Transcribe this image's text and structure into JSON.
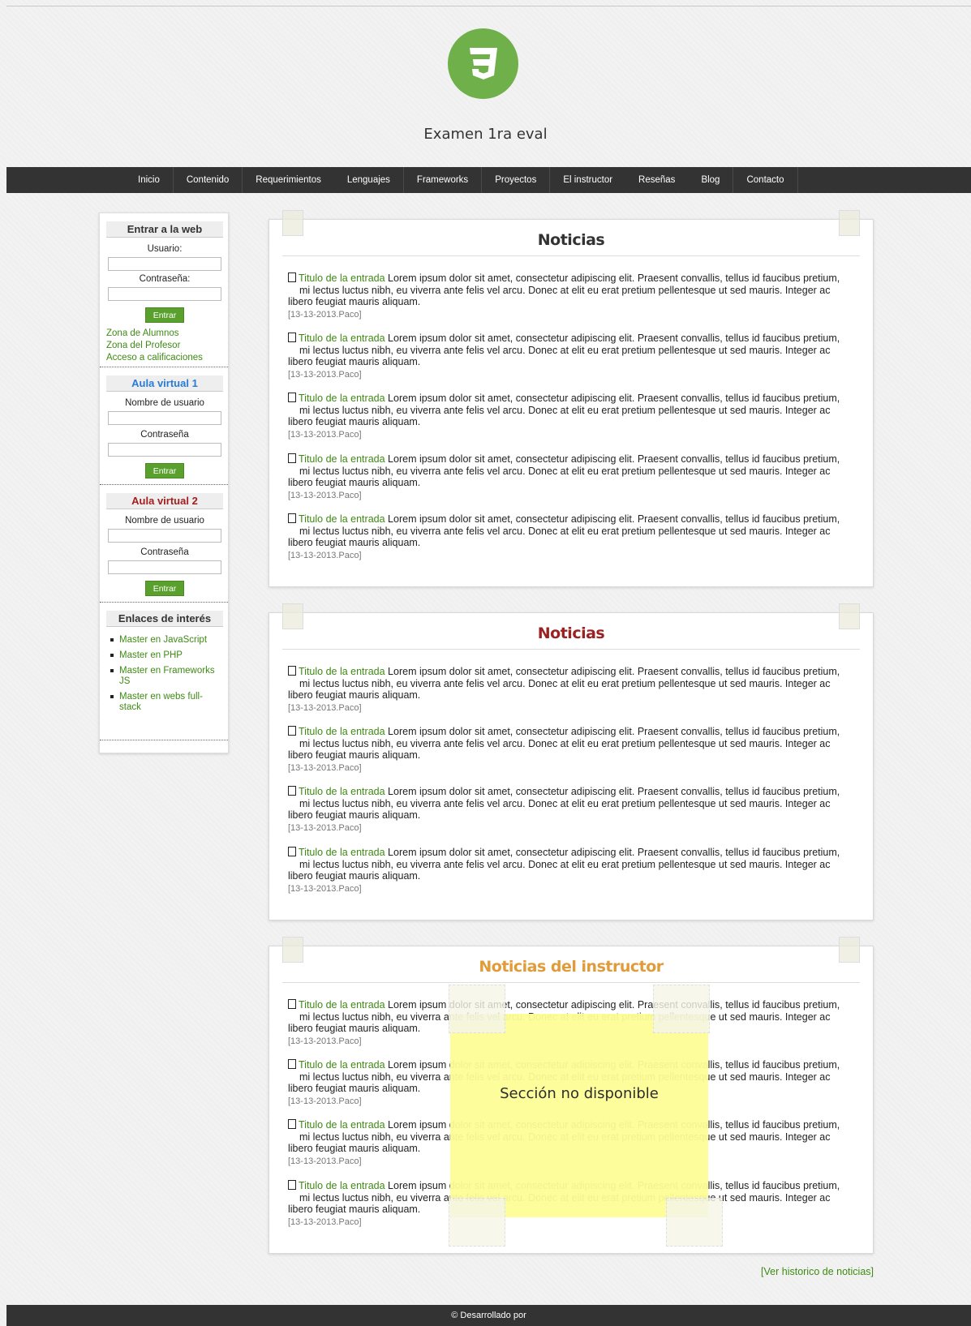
{
  "header": {
    "title": "Examen 1ra eval",
    "logo_icon": "css3-shield-icon"
  },
  "nav": {
    "items": [
      "Inicio",
      "Contenido",
      "Requerimientos",
      "Lenguajes",
      "Frameworks",
      "Proyectos",
      "El instructor",
      "Reseñas",
      "Blog",
      "Contacto"
    ]
  },
  "sidebar": {
    "login": {
      "title": "Entrar a la web",
      "user_label": "Usuario:",
      "pass_label": "Contraseña:",
      "button": "Entrar",
      "links": [
        "Zona de Alumnos",
        "Zona del Profesor",
        "Acceso a calificaciones"
      ]
    },
    "aula1": {
      "title": "Aula virtual 1",
      "user_label": "Nombre de usuario",
      "pass_label": "Contraseña",
      "button": "Entrar"
    },
    "aula2": {
      "title": "Aula virtual 2",
      "user_label": "Nombre de usuario",
      "pass_label": "Contraseña",
      "button": "Entrar"
    },
    "links": {
      "title": "Enlaces de interés",
      "items": [
        "Master en JavaScript",
        "Master en PHP",
        "Master en Frameworks JS",
        "Master en webs full-stack"
      ]
    }
  },
  "entry": {
    "title": "Titulo de la entrada",
    "text_first": "Lorem ipsum dolor sit amet, consectetur adipiscing elit. Praesent convallis, tellus id faucibus pretium,",
    "text_second": "mi lectus luctus nibh, eu viverra ante felis vel arcu. Donec at elit eu erat pretium pellentesque ut sed mauris. Integer ac",
    "text_third": "libero feugiat mauris aliquam.",
    "date": "[13-13-2013.Paco]"
  },
  "panels": {
    "p1_title": "Noticias",
    "p2_title": "Noticias",
    "p3_title": "Noticias del instructor"
  },
  "overlay": {
    "message": "Sección no disponible"
  },
  "history_link": "[Ver historico de noticias]",
  "footer": {
    "text": "© Desarrollado por"
  },
  "colors": {
    "accent_green": "#3f8a14",
    "nav_bg": "#333333",
    "overlay_yellow": "#fdfd97"
  }
}
